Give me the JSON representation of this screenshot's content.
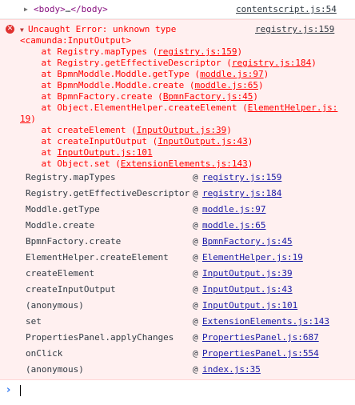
{
  "log": {
    "body_open": "<body>",
    "body_ellipsis": "…",
    "body_close": "</body>",
    "source": "contentscript.js:54"
  },
  "error": {
    "source": "registry.js:159",
    "message_line1": "Uncaught Error: unknown type",
    "message_line2": "<camunda:InputOutput>",
    "trace": [
      {
        "prefix": "    at Registry.mapTypes (",
        "link": "registry.js:159",
        "suffix": ")"
      },
      {
        "prefix": "    at Registry.getEffectiveDescriptor (",
        "link": "registry.js:184",
        "suffix": ")"
      },
      {
        "prefix": "    at BpmnModdle.Moddle.getType (",
        "link": "moddle.js:97",
        "suffix": ")"
      },
      {
        "prefix": "    at BpmnModdle.Moddle.create (",
        "link": "moddle.js:65",
        "suffix": ")"
      },
      {
        "prefix": "    at BpmnFactory.create (",
        "link": "BpmnFactory.js:45",
        "suffix": ")"
      },
      {
        "prefix": "    at Object.ElementHelper.createElement (",
        "link": "ElementHelper.js:",
        "suffix": ""
      },
      {
        "prefix": "",
        "link": "19",
        "suffix": ")"
      },
      {
        "prefix": "    at createElement (",
        "link": "InputOutput.js:39",
        "suffix": ")"
      },
      {
        "prefix": "    at createInputOutput (",
        "link": "InputOutput.js:43",
        "suffix": ")"
      },
      {
        "prefix": "    at ",
        "link": "InputOutput.js:101",
        "suffix": ""
      },
      {
        "prefix": "    at Object.set (",
        "link": "ExtensionElements.js:143",
        "suffix": ")"
      }
    ]
  },
  "stack": {
    "at_symbol": "@",
    "rows": [
      {
        "fn": "Registry.mapTypes",
        "link": "registry.js:159"
      },
      {
        "fn": "Registry.getEffectiveDescriptor",
        "link": "registry.js:184"
      },
      {
        "fn": "Moddle.getType",
        "link": "moddle.js:97"
      },
      {
        "fn": "Moddle.create",
        "link": "moddle.js:65"
      },
      {
        "fn": "BpmnFactory.create",
        "link": "BpmnFactory.js:45"
      },
      {
        "fn": "ElementHelper.createElement",
        "link": "ElementHelper.js:19"
      },
      {
        "fn": "createElement",
        "link": "InputOutput.js:39"
      },
      {
        "fn": "createInputOutput",
        "link": "InputOutput.js:43"
      },
      {
        "fn": "(anonymous)",
        "link": "InputOutput.js:101"
      },
      {
        "fn": "set",
        "link": "ExtensionElements.js:143"
      },
      {
        "fn": "PropertiesPanel.applyChanges",
        "link": "PropertiesPanel.js:687"
      },
      {
        "fn": "onClick",
        "link": "PropertiesPanel.js:554"
      },
      {
        "fn": "(anonymous)",
        "link": "index.js:35"
      }
    ]
  },
  "prompt": {
    "chevron": "›",
    "value": ""
  }
}
